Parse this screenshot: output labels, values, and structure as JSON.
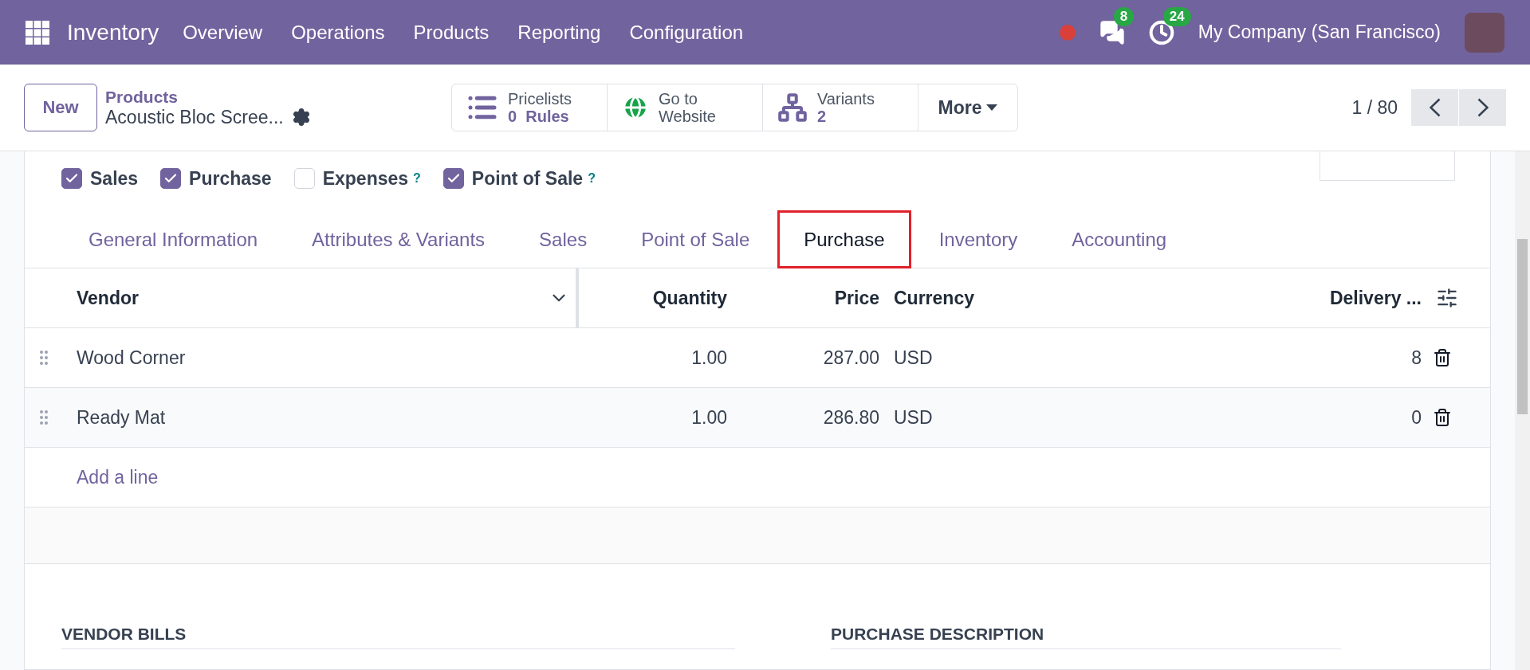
{
  "navbar": {
    "app": "Inventory",
    "menu": [
      "Overview",
      "Operations",
      "Products",
      "Reporting",
      "Configuration"
    ],
    "messages_badge": "8",
    "activities_badge": "24",
    "company": "My Company (San Francisco)"
  },
  "control_panel": {
    "new_button": "New",
    "breadcrumb": "Products",
    "record_name": "Acoustic Bloc Scree...",
    "smart_buttons": [
      {
        "kind": "pricelists",
        "label": "Pricelists",
        "value": "0",
        "unit": "Rules"
      },
      {
        "kind": "website",
        "label": "Go to",
        "value": "Website"
      },
      {
        "kind": "variants",
        "label": "Variants",
        "value": "2"
      }
    ],
    "more": "More",
    "pager": "1 / 80"
  },
  "checkboxes": [
    {
      "label": "Sales",
      "checked": true
    },
    {
      "label": "Purchase",
      "checked": true
    },
    {
      "label": "Expenses",
      "checked": false,
      "help": "?"
    },
    {
      "label": "Point of Sale",
      "checked": true,
      "help": "?"
    }
  ],
  "tabs": [
    {
      "label": "General Information",
      "selected": false
    },
    {
      "label": "Attributes & Variants",
      "selected": false
    },
    {
      "label": "Sales",
      "selected": false
    },
    {
      "label": "Point of Sale",
      "selected": false
    },
    {
      "label": "Purchase",
      "selected": true
    },
    {
      "label": "Inventory",
      "selected": false
    },
    {
      "label": "Accounting",
      "selected": false
    }
  ],
  "table": {
    "columns": [
      "Vendor",
      "Quantity",
      "Price",
      "Currency",
      "Delivery ..."
    ],
    "rows": [
      {
        "vendor": "Wood Corner",
        "quantity": "1.00",
        "price": "287.00",
        "currency": "USD",
        "delivery": "8"
      },
      {
        "vendor": "Ready Mat",
        "quantity": "1.00",
        "price": "286.80",
        "currency": "USD",
        "delivery": "0"
      }
    ],
    "add_line": "Add a line"
  },
  "sections": [
    "VENDOR BILLS",
    "PURCHASE DESCRIPTION"
  ]
}
